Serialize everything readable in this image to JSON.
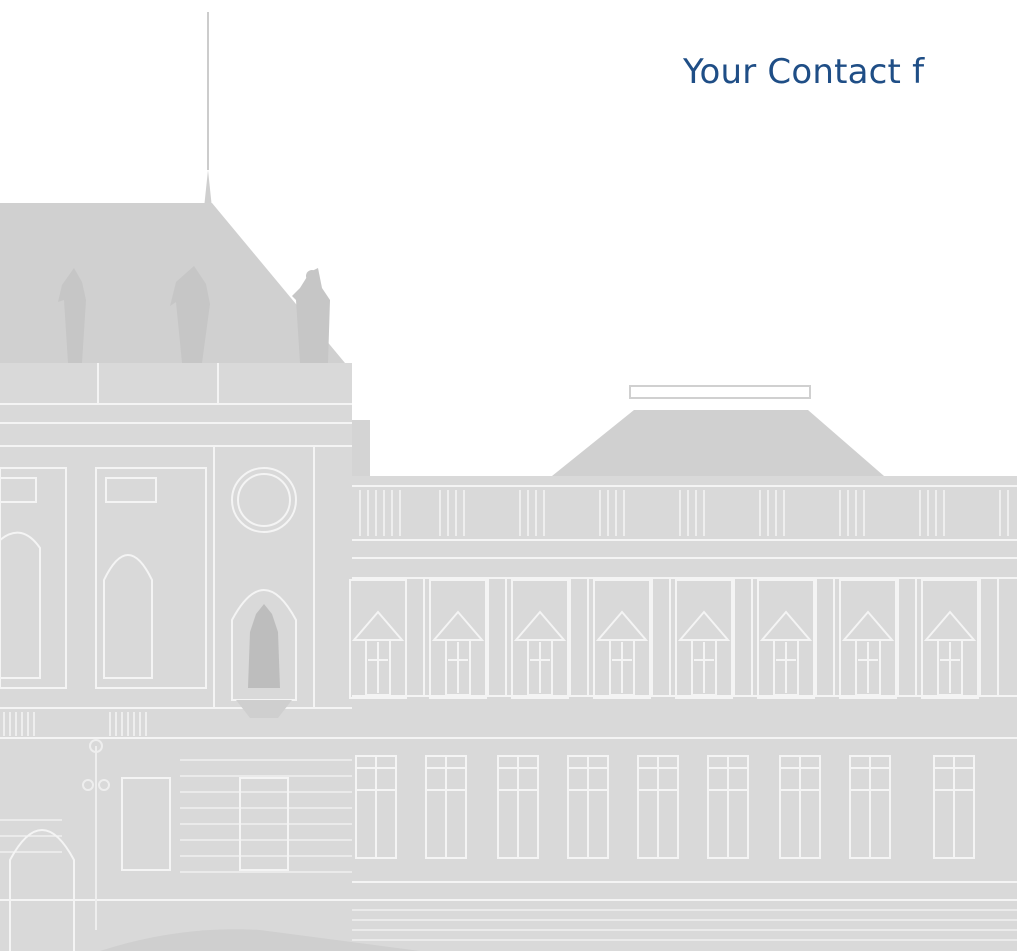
{
  "heading": {
    "text": "Your Contact f"
  },
  "illustration": {
    "subject": "building-facade",
    "colors": {
      "fill": "#d9d9d9",
      "fill_dark": "#c8c9ca",
      "line": "#f4f4f4",
      "heading": "#1f4e86"
    }
  }
}
